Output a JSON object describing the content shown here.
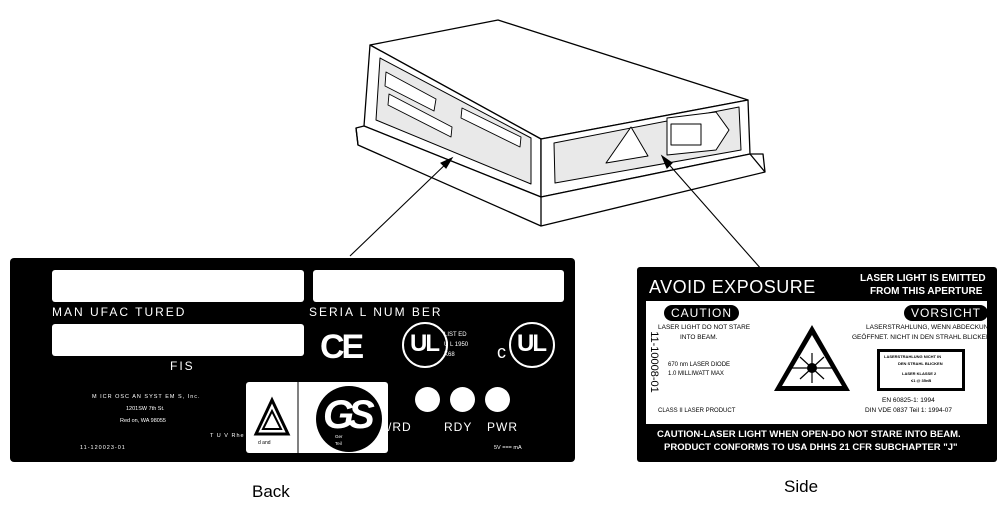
{
  "captions": {
    "back": "Back",
    "side": "Side"
  },
  "back_label": {
    "manufactured": "MAN UFAC TURED",
    "serial_number": "SERIA L NUM BER",
    "fis": "FIS",
    "ce_mark": "CE",
    "ul_mark": "UL",
    "c_prefix": "c",
    "ul_listed": "LIST ED",
    "ul_code": "U L 1950",
    "ul_ref": "K68",
    "company": "M ICR OSC AN SYST EM S, Inc.",
    "address_street": "1201SW 7th St.",
    "address_city": "Red on, WA 98055",
    "tuv": "T U V Rhe",
    "part_number": "11-120023-01",
    "gs_mark": "GS",
    "gs_small_1": "d and",
    "gs_small_2": "Ger",
    "gs_small_3": "Teil",
    "led_labels": {
      "gd": "/RD",
      "rdy": "RDY",
      "pwr": "PWR"
    },
    "power_rating": "5V  ===  mA"
  },
  "side_label": {
    "avoid_exposure": "AVOID EXPOSURE",
    "aperture_1": "LASER LIGHT IS  EMITTED",
    "aperture_2": "FROM THIS APERTURE",
    "caution": "CAUTION",
    "caution_text_1": "LASER LIGHT DO NOT STARE",
    "caution_text_2": "INTO BEAM.",
    "diode_1": "670 nm LASER DIODE",
    "diode_2": "1.0 MILLIWATT MAX",
    "class_text": "CLASS II LASER PRODUCT",
    "vorsicht": "VORSICHT",
    "vorsicht_text_1": "LASERSTRAHLUNG, WENN ABDECKUNG",
    "vorsicht_text_2": "GEÖFFNET. NICHT IN DEN STRAHL BLICKEN",
    "german_box_1": "LASERSTRAHLUNG NICHT IN",
    "german_box_2": "DEN STRAHL BLICKEN",
    "german_box_3": "LASER KLASSE 2",
    "german_box_4": "≤1 @ 35nB",
    "en_standard": "EN 60825-1: 1994",
    "din_standard": "DIN VDE 0837 Teil 1: 1994-07",
    "vertical_pn": "11-10008-01",
    "footer_1": "CAUTION-LASER LIGHT WHEN OPEN-DO NOT STARE INTO BEAM.",
    "footer_2": "PRODUCT CONFORMS TO USA DHHS 21 CFR SUBCHAPTER \"J\""
  }
}
